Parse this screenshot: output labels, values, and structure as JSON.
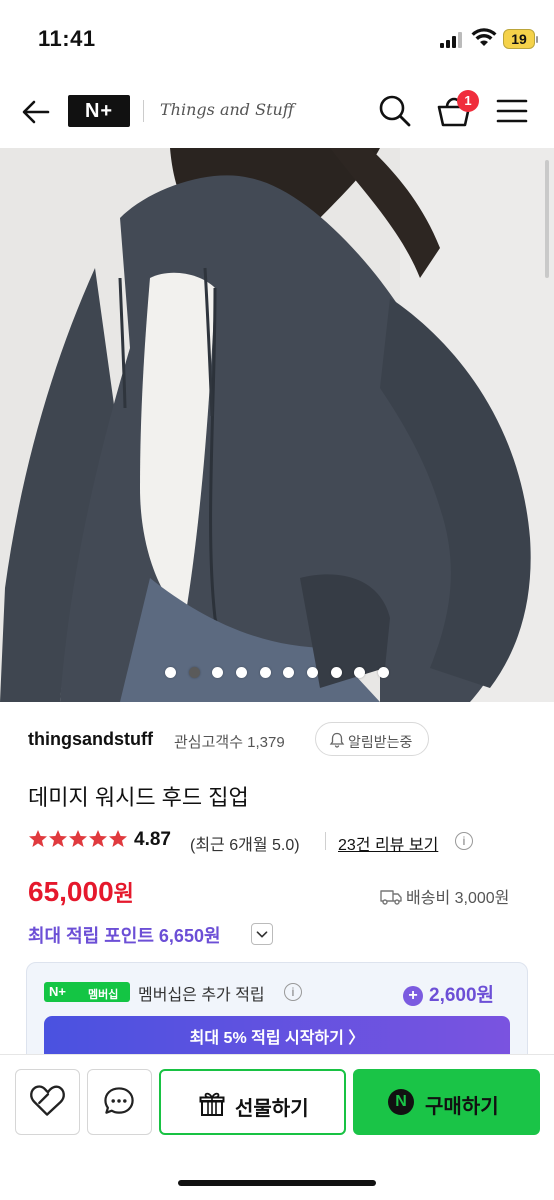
{
  "status_bar": {
    "time": "11:41",
    "battery": "19"
  },
  "header": {
    "brand_logo": "N+",
    "store_logo": "Things and Stuff",
    "cart_count": "1"
  },
  "gallery": {
    "dot_count": 10,
    "active_index": 1
  },
  "store": {
    "name": "thingsandstuff",
    "followers": "관심고객수 1,379",
    "alert_label": "알림받는중"
  },
  "product": {
    "title": "데미지 워시드 후드 집업",
    "rating": "4.87",
    "rating_stars": 5,
    "recent_rating": "(최근 6개월 5.0)",
    "review_link": "23건 리뷰 보기",
    "price": "65,000",
    "price_unit": "원",
    "shipping": "배송비 3,000원",
    "max_points": "최대 적립 포인트 6,650원"
  },
  "membership": {
    "badge_brand": "N+",
    "badge_label": "멤버십",
    "text": "멤버십은 추가 적립",
    "points": "2,600원",
    "start_button": "최대 5% 적립 시작하기 〉"
  },
  "bottom_bar": {
    "gift_label": "선물하기",
    "buy_label": "구매하기",
    "buy_icon": "N"
  },
  "colors": {
    "price_red": "#e5182c",
    "points_purple": "#6c4fd6",
    "naver_green": "#1ac447",
    "star_red": "#e03a3e"
  }
}
